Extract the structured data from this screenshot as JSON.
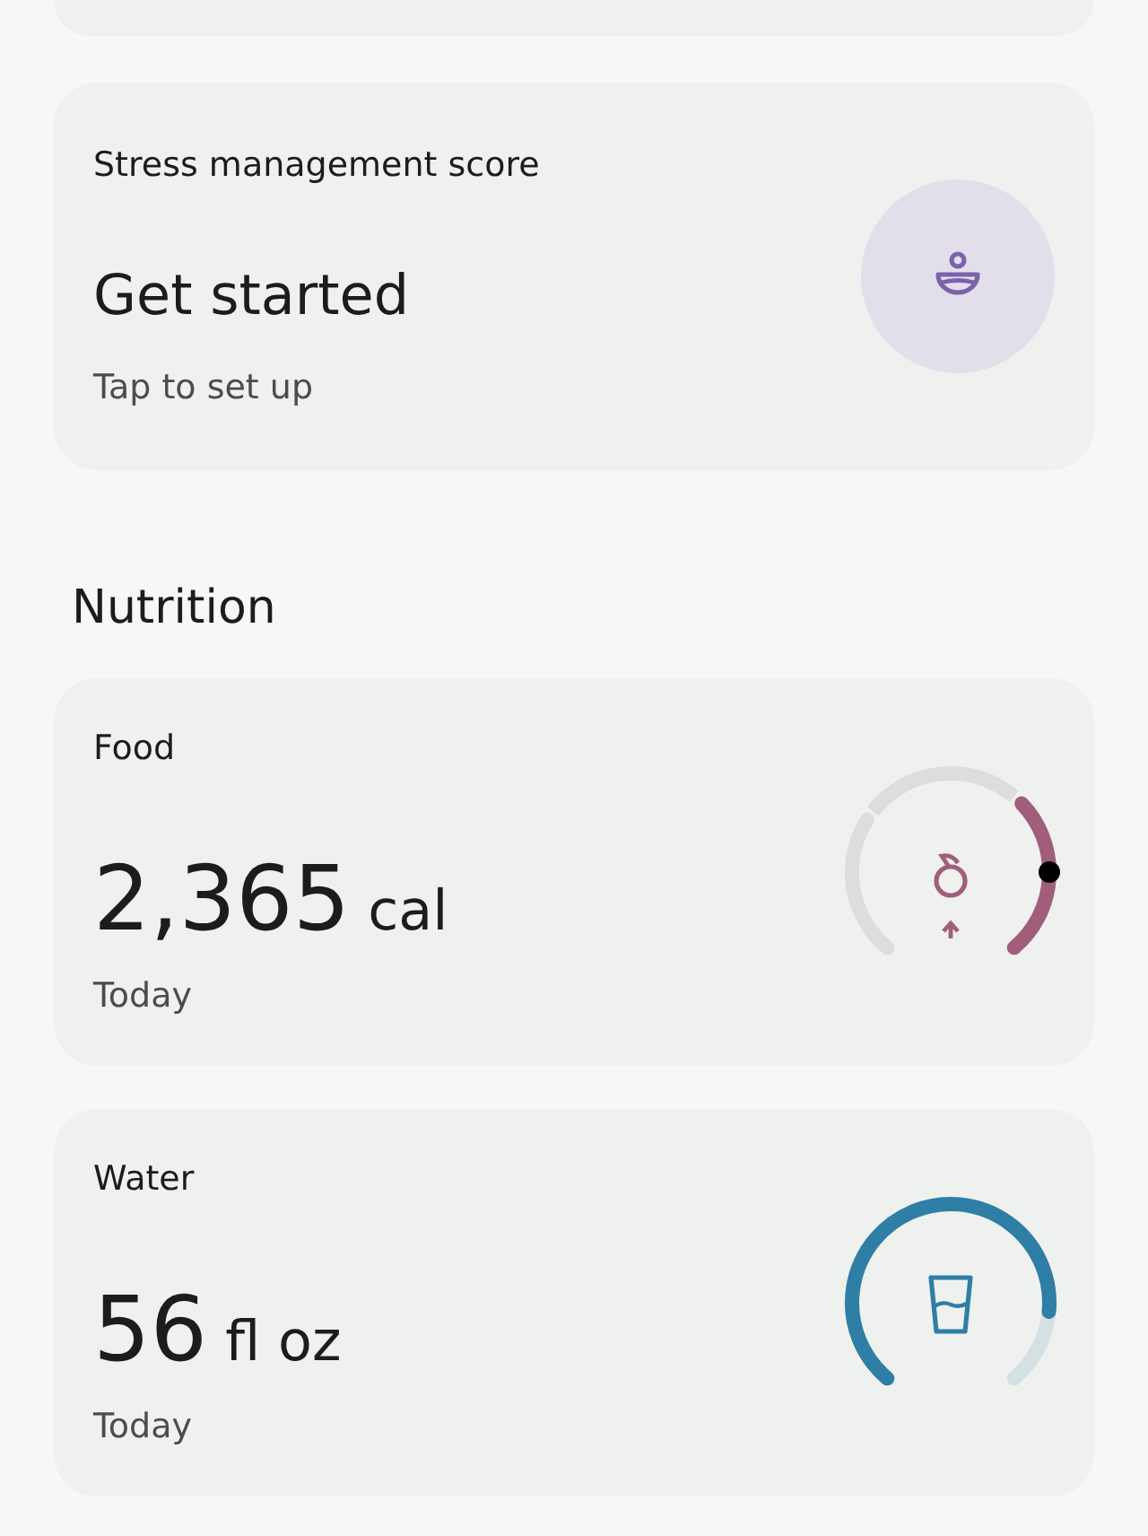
{
  "stress": {
    "title": "Stress management score",
    "value": "Get started",
    "subtitle": "Tap to set up"
  },
  "section": "Nutrition",
  "food": {
    "title": "Food",
    "value": "2,365",
    "unit": "cal",
    "subtitle": "Today"
  },
  "water": {
    "title": "Water",
    "value": "56",
    "unit": "fl oz",
    "subtitle": "Today"
  }
}
